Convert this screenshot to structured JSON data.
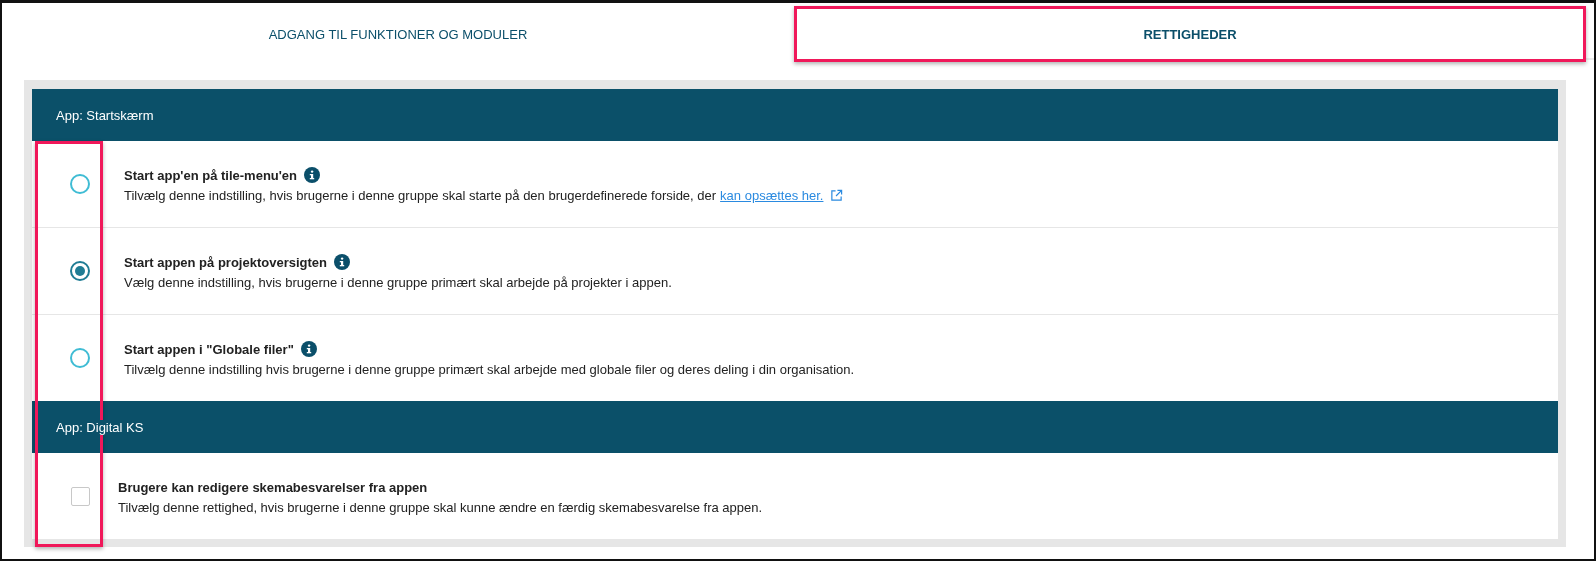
{
  "tabs": [
    {
      "label": "ADGANG TIL FUNKTIONER OG MODULER",
      "selected": false,
      "highlighted": false
    },
    {
      "label": "RETTIGHEDER",
      "selected": true,
      "highlighted": true
    }
  ],
  "controls_highlighted": true,
  "sections": [
    {
      "title": "App: Startskærm",
      "options": [
        {
          "kind": "radio",
          "selected": false,
          "title": "Start app'en på tile-menu'en",
          "info": true,
          "description": "Tilvælg denne indstilling, hvis brugerne i denne gruppe skal starte på den brugerdefinerede forside, der",
          "link": "kan opsættes her."
        },
        {
          "kind": "radio",
          "selected": true,
          "title": "Start appen på projektoversigten",
          "info": true,
          "description": "Vælg denne indstilling, hvis brugerne i denne gruppe primært skal arbejde på projekter i appen."
        },
        {
          "kind": "radio",
          "selected": false,
          "title": "Start appen i \"Globale filer\"",
          "info": true,
          "description": "Tilvælg denne indstilling hvis brugerne i denne gruppe primært skal arbejde med globale filer og deres deling i din organisation."
        }
      ]
    },
    {
      "title": "App: Digital KS",
      "options": [
        {
          "kind": "checkbox",
          "checked": false,
          "title": "Brugere kan redigere skemabesvarelser fra appen",
          "info": false,
          "description": "Tilvælg denne rettighed, hvis brugerne i denne gruppe skal kunne ændre en færdig skemabesvarelse fra appen."
        }
      ]
    }
  ]
}
